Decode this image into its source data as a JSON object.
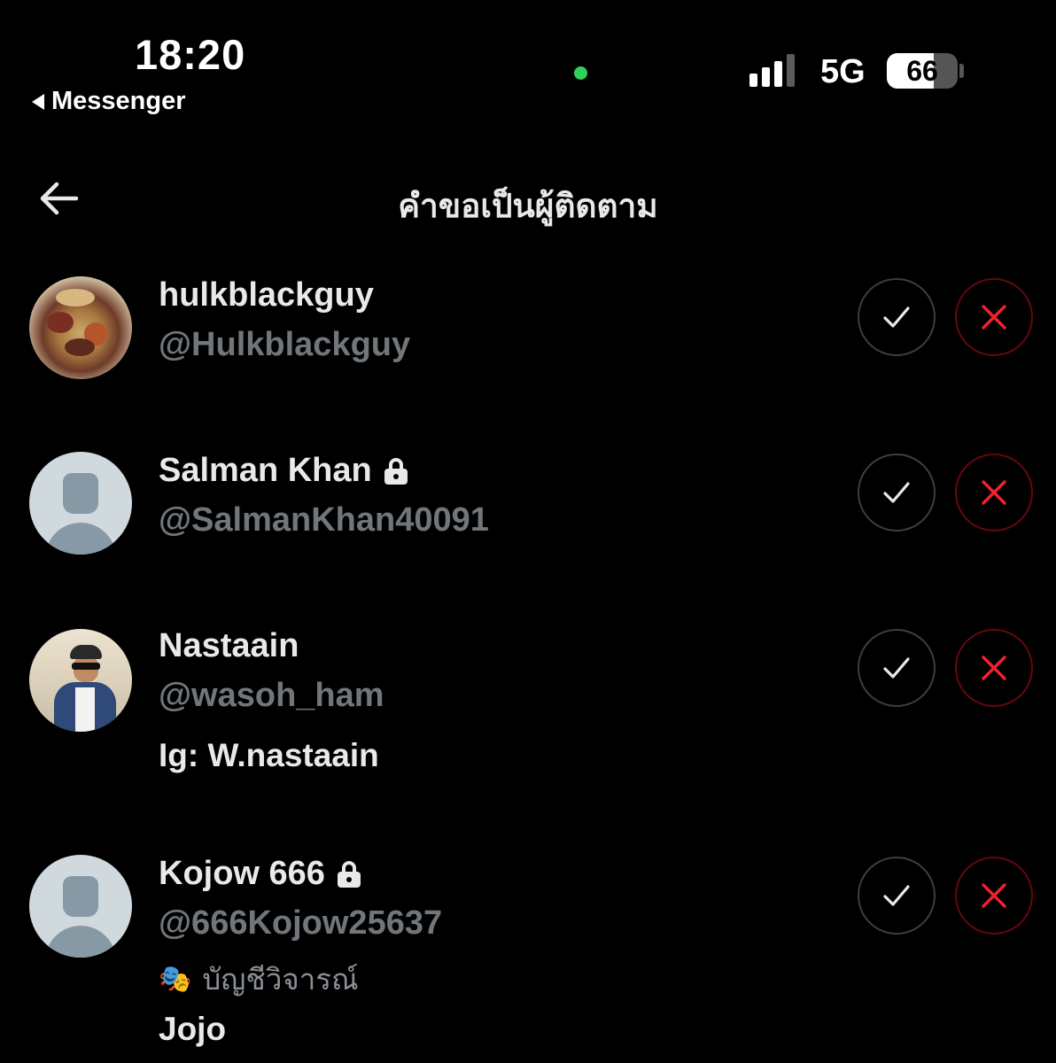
{
  "status_bar": {
    "time": "18:20",
    "back_app": "Messenger",
    "network": "5G",
    "battery": "66",
    "battery_level": 0.66,
    "signal_bars": 3
  },
  "header": {
    "title": "คำขอเป็นผู้ติดตาม",
    "back_icon": "back-arrow-icon"
  },
  "colors": {
    "background": "#000000",
    "primary_text": "#e7e9ea",
    "secondary_text": "#71767b",
    "accept_border": "#3a3f44",
    "reject_border": "#67070f",
    "reject_icon": "#f4212e",
    "status_dot": "#30d158"
  },
  "requests": [
    {
      "name": "hulkblackguy",
      "handle": "@Hulkblackguy",
      "protected": false,
      "avatar": "food-photo"
    },
    {
      "name": "Salman Khan",
      "handle": "@SalmanKhan40091",
      "protected": true,
      "avatar": "default-avatar"
    },
    {
      "name": "Nastaain",
      "handle": "@wasoh_ham",
      "bio": "Ig: W.nastaain",
      "protected": false,
      "avatar": "person-photo"
    },
    {
      "name": "Kojow 666",
      "handle": "@666Kojow25637",
      "label": "บัญชีวิจารณ์",
      "bio": "Jojo",
      "protected": true,
      "avatar": "default-avatar"
    }
  ],
  "actions": {
    "accept_icon": "check-icon",
    "reject_icon": "x-icon"
  }
}
